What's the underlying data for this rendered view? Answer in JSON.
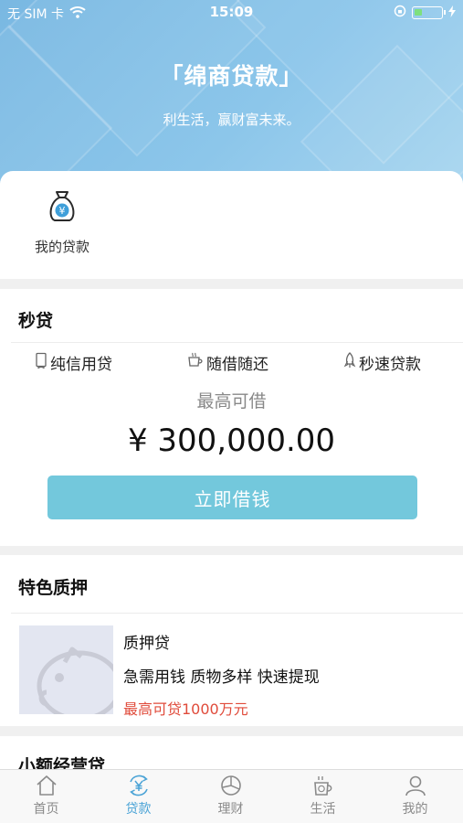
{
  "status_bar": {
    "carrier": "无 SIM 卡",
    "time": "15:09",
    "battery_level": 0.3,
    "wifi_icon": "wifi-icon",
    "lock_icon": "rotation-lock-icon",
    "charging_icon": "charging-bolt-icon"
  },
  "hero": {
    "title": "「绵商贷款」",
    "subtitle": "利生活，赢财富未来。"
  },
  "my_loans": {
    "label": "我的贷款",
    "icon": "money-bag-icon"
  },
  "flash_loan": {
    "title": "秒贷",
    "features": [
      {
        "label": "纯信用贷",
        "icon": "credit-card-icon"
      },
      {
        "label": "随借随还",
        "icon": "cup-icon"
      },
      {
        "label": "秒速贷款",
        "icon": "rocket-icon"
      }
    ],
    "max_label": "最高可借",
    "amount": "¥ 300,000.00",
    "button_label": "立即借钱"
  },
  "pledge": {
    "title": "特色质押",
    "product_name": "质押贷",
    "product_desc": "急需用钱 质物多样 快速提现",
    "product_limit": "最高可贷1000万元",
    "image_icon": "piggy-bank-icon"
  },
  "micro": {
    "title": "小额经营贷"
  },
  "tabbar": {
    "tabs": [
      {
        "label": "首页",
        "icon": "home-icon"
      },
      {
        "label": "贷款",
        "icon": "yen-cycle-icon"
      },
      {
        "label": "理财",
        "icon": "pie-chart-icon"
      },
      {
        "label": "生活",
        "icon": "coffee-coin-icon"
      },
      {
        "label": "我的",
        "icon": "user-icon"
      }
    ],
    "active_index": 1
  },
  "colors": {
    "accent": "#4aa3d6",
    "button": "#73c8dc",
    "highlight_red": "#e04b3b",
    "hero_gradient_start": "#79b8e2"
  }
}
